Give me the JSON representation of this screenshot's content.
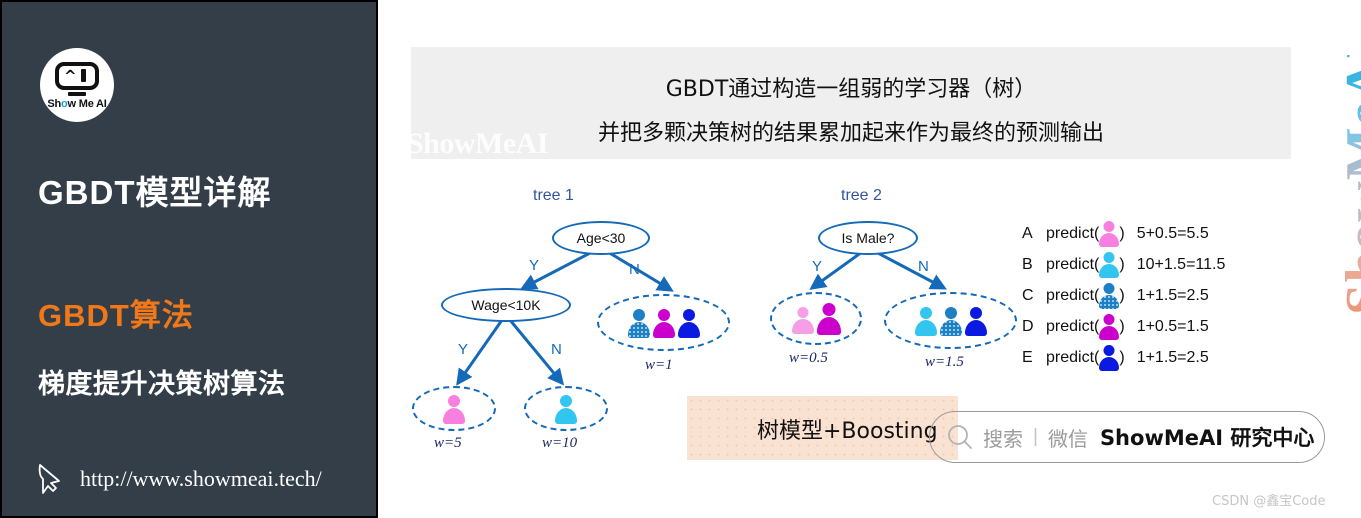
{
  "sidebar": {
    "logo": {
      "caret": "^",
      "brand_prefix": "Sh",
      "brand_o": "o",
      "brand_suffix": "w Me AI"
    },
    "title_main": "GBDT模型详解",
    "title_algo": "GBDT算法",
    "title_sub": "梯度提升决策树算法",
    "url": "http://www.showmeai.tech/",
    "bg_color": "#333e48",
    "accent_color": "#f07818"
  },
  "banner": {
    "line1": "GBDT通过构造一组弱的学习器（树）",
    "line2": "并把多颗决策树的结果累加起来作为最终的预测输出",
    "watermark": "ShowMeAI",
    "bg_color": "#efefef"
  },
  "side_watermark": "ShowMeAI",
  "trees": [
    {
      "label": "tree 1",
      "nodes": [
        {
          "id": "root",
          "text": "Age<30"
        },
        {
          "id": "wage",
          "text": "Wage<10K"
        }
      ],
      "edges": [
        {
          "from": "root",
          "to": "wage",
          "label": "Y"
        },
        {
          "from": "root",
          "to": "leaf_w1",
          "label": "N"
        },
        {
          "from": "wage",
          "to": "leaf_w5",
          "label": "Y"
        },
        {
          "from": "wage",
          "to": "leaf_w10",
          "label": "N"
        }
      ],
      "leaves": [
        {
          "id": "leaf_w1",
          "weight": "w=1",
          "people": [
            "steel-blue-dotted",
            "magenta",
            "blue"
          ]
        },
        {
          "id": "leaf_w5",
          "weight": "w=5",
          "people": [
            "pink"
          ]
        },
        {
          "id": "leaf_w10",
          "weight": "w=10",
          "people": [
            "cyan"
          ]
        }
      ]
    },
    {
      "label": "tree 2",
      "nodes": [
        {
          "id": "root2",
          "text": "Is Male?"
        }
      ],
      "edges": [
        {
          "from": "root2",
          "to": "leaf_w05",
          "label": "Y"
        },
        {
          "from": "root2",
          "to": "leaf_w15",
          "label": "N"
        }
      ],
      "leaves": [
        {
          "id": "leaf_w05",
          "weight": "w=0.5",
          "people": [
            "pink",
            "magenta"
          ]
        },
        {
          "id": "leaf_w15",
          "weight": "w=1.5",
          "people": [
            "cyan",
            "steel-blue-dotted",
            "blue"
          ]
        }
      ]
    }
  ],
  "predictions": {
    "fn_open": "predict(",
    "fn_close": ")",
    "rows": [
      {
        "key": "A",
        "person": "pink",
        "value": "5+0.5=5.5"
      },
      {
        "key": "B",
        "person": "cyan",
        "value": "10+1.5=11.5"
      },
      {
        "key": "C",
        "person": "steel-blue-dotted",
        "value": "1+1.5=2.5"
      },
      {
        "key": "D",
        "person": "magenta",
        "value": "1+0.5=1.5"
      },
      {
        "key": "E",
        "person": "blue",
        "value": "1+1.5=2.5"
      }
    ]
  },
  "bottom": {
    "peach_label": "树模型+Boosting",
    "search_placeholder": "搜索",
    "search_divider": "|",
    "search_channel": "微信",
    "search_brand": "ShowMeAI 研究中心"
  },
  "watermark_csdn": "CSDN @鑫宝Code",
  "palette": {
    "node_blue": "#1469b8",
    "label_blue": "#33559a",
    "pink": "#f77fe0",
    "magenta": "#cc00cc",
    "cyan": "#31c5f0",
    "steel_blue_dotted": "#1d7fc4",
    "blue": "#0a1ae0"
  }
}
